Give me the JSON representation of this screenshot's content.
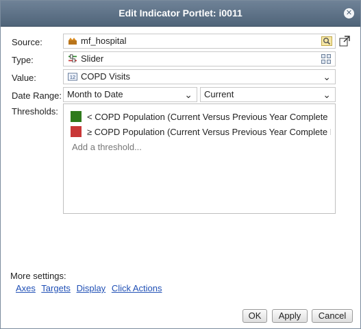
{
  "dialog": {
    "title": "Edit Indicator Portlet: i0011"
  },
  "form": {
    "source": {
      "label": "Source:",
      "value": "mf_hospital",
      "icon": "database-icon",
      "browse_icon": "search-icon"
    },
    "type": {
      "label": "Type:",
      "value": "Slider",
      "icon": "slider-type-icon",
      "picker_icon": "grid-icon"
    },
    "value": {
      "label": "Value:",
      "value": "COPD Visits",
      "icon": "numeric-12-icon"
    },
    "date_range": {
      "label": "Date Range:",
      "period": "Month to Date",
      "comparison": "Current"
    },
    "thresholds": {
      "label": "Thresholds:",
      "items": [
        {
          "text": "< COPD Population (Current Versus Previous Year Complete Month)",
          "color": "#2f7a1c"
        },
        {
          "text": "≥ COPD Population (Current Versus Previous Year Complete Month)",
          "color": "#c83737"
        }
      ],
      "add_link": "Add a threshold..."
    }
  },
  "more_settings": {
    "label": "More settings:",
    "links": [
      "Axes",
      "Targets",
      "Display",
      "Click Actions"
    ]
  },
  "buttons": {
    "ok": "OK",
    "apply": "Apply",
    "cancel": "Cancel"
  }
}
